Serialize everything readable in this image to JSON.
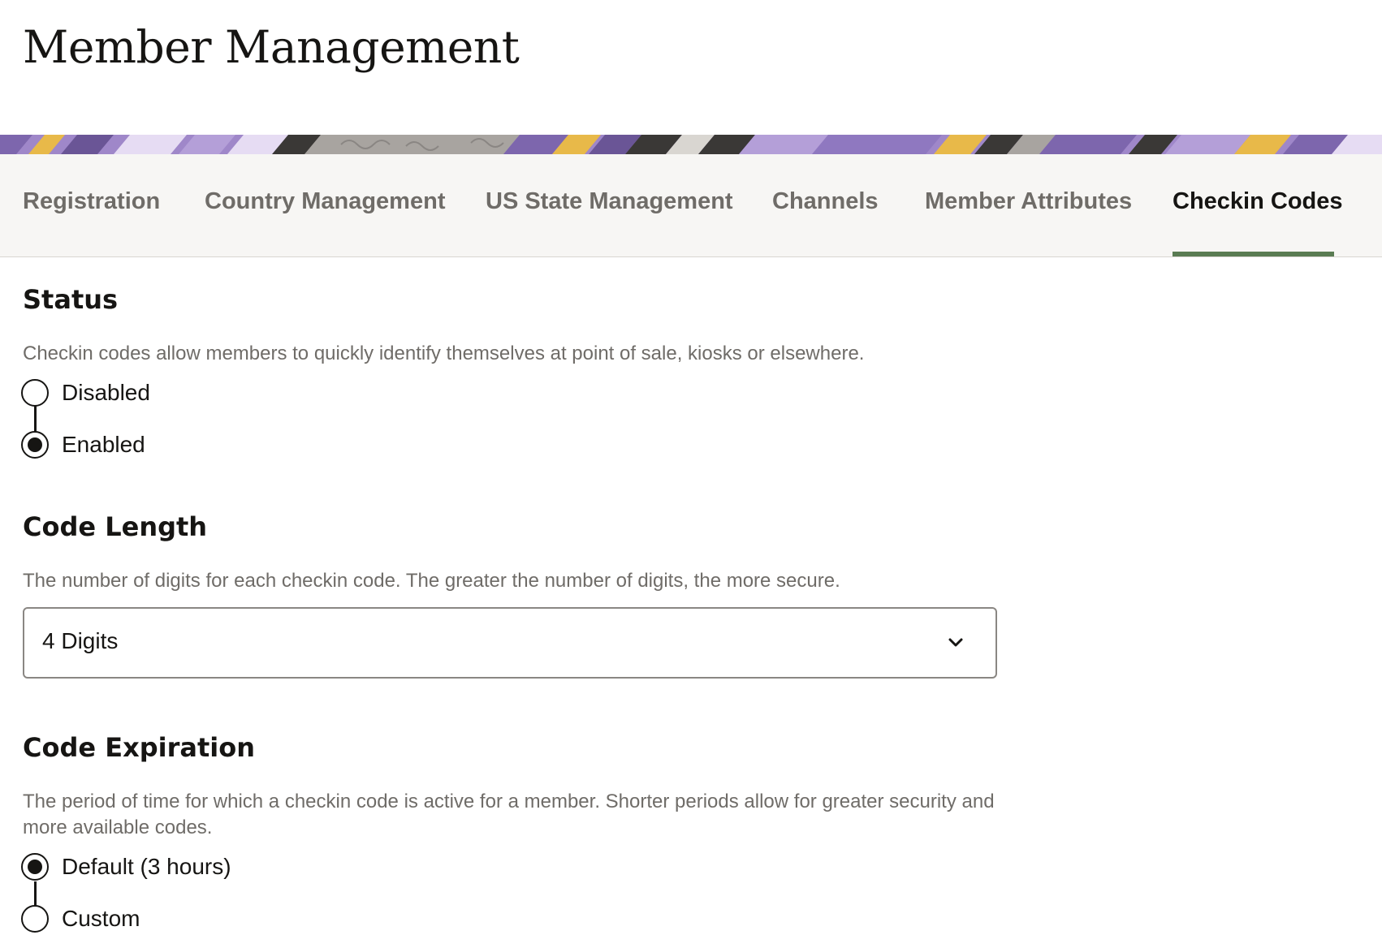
{
  "page": {
    "title": "Member Management"
  },
  "tabs": [
    {
      "label": "Registration",
      "active": false
    },
    {
      "label": "Country Management",
      "active": false
    },
    {
      "label": "US State Management",
      "active": false
    },
    {
      "label": "Channels",
      "active": false
    },
    {
      "label": "Member Attributes",
      "active": false
    },
    {
      "label": "Checkin Codes",
      "active": true
    }
  ],
  "status": {
    "heading": "Status",
    "description": "Checkin codes allow members to quickly identify themselves at point of sale, kiosks or elsewhere.",
    "options": [
      {
        "label": "Disabled",
        "checked": false
      },
      {
        "label": "Enabled",
        "checked": true
      }
    ]
  },
  "code_length": {
    "heading": "Code Length",
    "description": "The number of digits for each checkin code. The greater the number of digits, the more secure.",
    "selected": "4 Digits",
    "icon": "chevron-down-icon"
  },
  "code_expiration": {
    "heading": "Code Expiration",
    "description": "The period of time for which a checkin code is active for a member. Shorter periods allow for greater security and more available codes.",
    "options": [
      {
        "label": "Default (3 hours)",
        "checked": true
      },
      {
        "label": "Custom",
        "checked": false
      }
    ]
  },
  "colors": {
    "active_tab_indicator": "#5a7c53",
    "tab_bar_background": "#f7f6f4",
    "muted_text": "#6f6c68",
    "banner_purple": "#9f87c9",
    "banner_yellow": "#e8b949"
  }
}
